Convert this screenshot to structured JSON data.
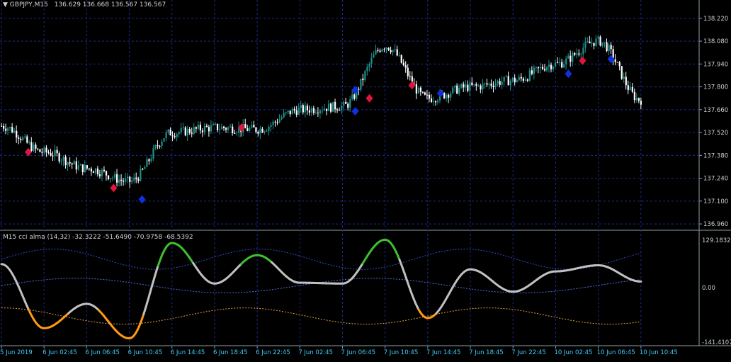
{
  "main_chart": {
    "symbol_header": "GBPJPY,M15",
    "ohlc_header": "136.629 136.668 136.567 136.567",
    "y_range": [
      136.93,
      138.28
    ],
    "price_labels": [
      "138.220",
      "138.080",
      "137.940",
      "137.800",
      "137.660",
      "137.520",
      "137.380",
      "137.240",
      "137.100",
      "136.960"
    ],
    "colors": {
      "bull": "#1f8f8a",
      "bear": "#ffffff",
      "grid": "#1a2a8c",
      "up_marker": "#e0143c",
      "down_marker": "#1030e0"
    }
  },
  "indicator": {
    "header": "M15 cci alma (14,32) -32.3222 -51.6490 -70.9758 -68.5392",
    "y_range": [
      -141.4107,
      129.1832
    ],
    "price_labels": [
      "129.1832",
      "0.00",
      "-141.4107"
    ],
    "colors": {
      "up": "#3fbf2f",
      "down": "#ff9a10",
      "neutral": "#c0c0c0",
      "upper_band": "#3050d0",
      "lower_band": "#e0a040",
      "mid_band": "#5070e0"
    }
  },
  "time_axis": {
    "labels": [
      "5 Jun 2019",
      "6 Jun 02:45",
      "6 Jun 06:45",
      "6 Jun 10:45",
      "6 Jun 14:45",
      "6 Jun 18:45",
      "6 Jun 22:45",
      "7 Jun 02:45",
      "7 Jun 06:45",
      "7 Jun 10:45",
      "7 Jun 14:45",
      "7 Jun 18:45",
      "7 Jun 22:45",
      "10 Jun 02:45",
      "10 Jun 06:45",
      "10 Jun 10:45"
    ]
  },
  "chart_data": {
    "type": "line",
    "x": [
      "5 Jun 2019",
      "6 Jun 02:45",
      "6 Jun 06:45",
      "6 Jun 10:45",
      "6 Jun 14:45",
      "6 Jun 18:45",
      "6 Jun 22:45",
      "7 Jun 02:45",
      "7 Jun 06:45",
      "7 Jun 10:45",
      "7 Jun 14:45",
      "7 Jun 18:45",
      "7 Jun 22:45",
      "10 Jun 02:45",
      "10 Jun 06:45",
      "10 Jun 10:45"
    ],
    "series": [
      {
        "name": "GBPJPY,M15",
        "values": [
          137.56,
          137.4,
          137.3,
          137.22,
          137.52,
          137.55,
          137.54,
          137.66,
          137.68,
          138.05,
          137.73,
          137.8,
          137.84,
          137.94,
          138.08,
          137.72
        ]
      },
      {
        "name": "M15 cci alma (14,32)",
        "values": [
          58,
          -100,
          -40,
          -125,
          110,
          10,
          80,
          12,
          10,
          118,
          -75,
          45,
          -10,
          40,
          55,
          15
        ]
      }
    ],
    "ylim": [
      136.93,
      138.28
    ],
    "markers": {
      "up": [
        [
          "5 Jun 2019",
          137.4
        ],
        [
          "6 Jun 06:45",
          137.18
        ],
        [
          "6 Jun 18:45",
          137.55
        ],
        [
          "7 Jun 06:45",
          137.73
        ],
        [
          "7 Jun 10:45",
          137.81
        ],
        [
          "10 Jun 02:45",
          137.96
        ]
      ],
      "down": [
        [
          "6 Jun 10:45",
          137.11
        ],
        [
          "7 Jun 06:45",
          137.65
        ],
        [
          "7 Jun 06:45",
          137.78
        ],
        [
          "7 Jun 14:45",
          137.76
        ],
        [
          "10 Jun 02:45",
          137.88
        ],
        [
          "10 Jun 06:45",
          137.97
        ]
      ]
    }
  }
}
